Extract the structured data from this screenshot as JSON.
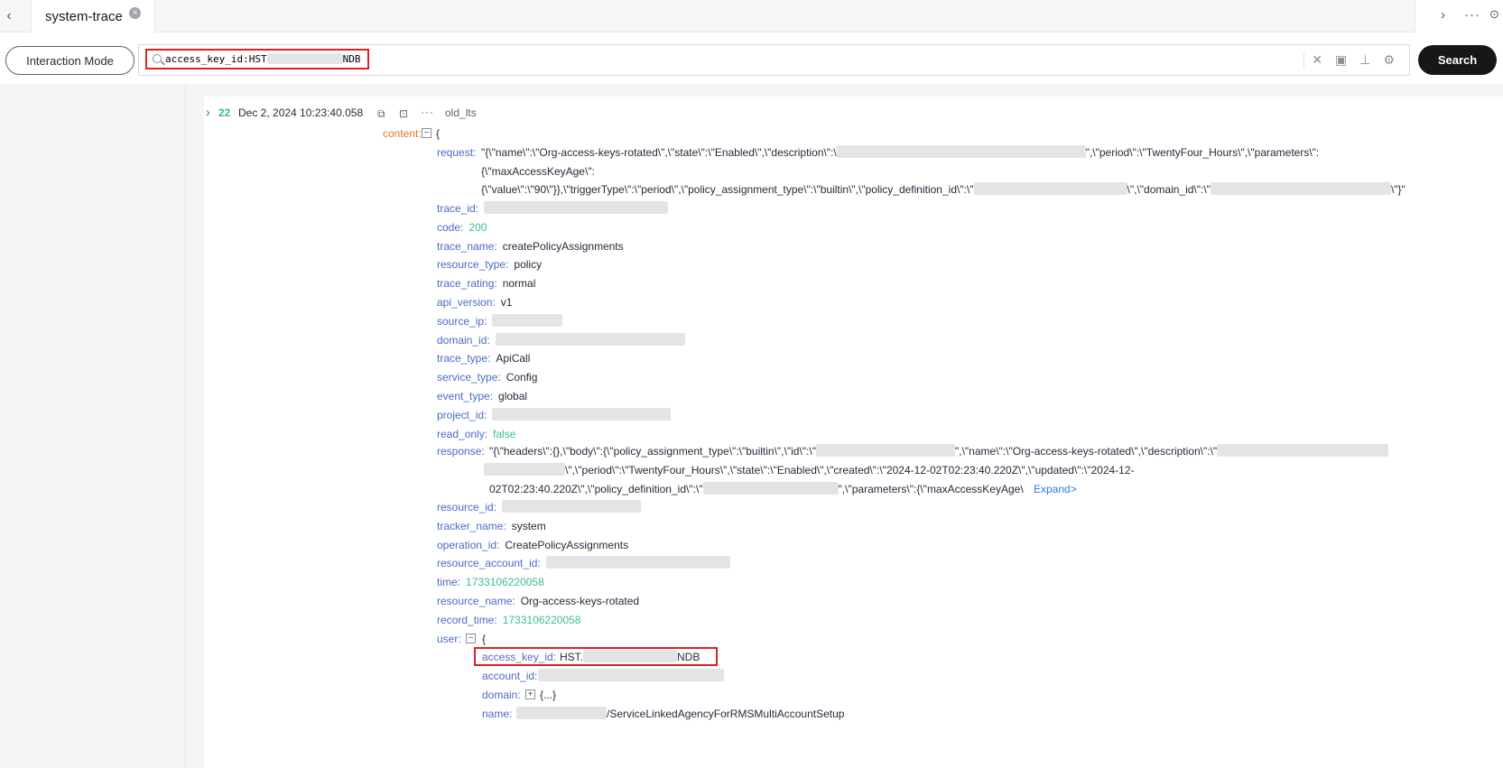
{
  "tabbar": {
    "tab_label": "system-trace"
  },
  "toolbar": {
    "interaction_mode_label": "Interaction Mode",
    "search_query_prefix": "access_key_id:HST",
    "search_query_suffix": "NDB",
    "search_button_label": "Search"
  },
  "log": {
    "row_number": "22",
    "timestamp": "Dec 2, 2024 10:23:40.058",
    "source": "old_lts",
    "content_key": "content:",
    "open_brace": "{",
    "request": {
      "key": "request:",
      "line1_a": "\"{\\\"name\\\":\\\"Org-access-keys-rotated\\\",\\\"state\\\":\\\"Enabled\\\",\\\"description\\\":\\",
      "line1_b": "\",\\\"period\\\":\\\"TwentyFour_Hours\\\",\\\"parameters\\\":",
      "line2": "{\\\"maxAccessKeyAge\\\":",
      "line3_a": "{\\\"value\\\":\\\"90\\\"}},\\\"triggerType\\\":\\\"period\\\",\\\"policy_assignment_type\\\":\\\"builtin\\\",\\\"policy_definition_id\\\":\\\"",
      "line3_b": "\\\",\\\"domain_id\\\":\\\"",
      "line3_c": "\\\"}\""
    },
    "fields": [
      {
        "key": "trace_id:",
        "value": "",
        "kind": "blur"
      },
      {
        "key": "code:",
        "value": "200",
        "kind": "num"
      },
      {
        "key": "trace_name:",
        "value": "createPolicyAssignments",
        "kind": "text"
      },
      {
        "key": "resource_type:",
        "value": "policy",
        "kind": "text"
      },
      {
        "key": "trace_rating:",
        "value": "normal",
        "kind": "text"
      },
      {
        "key": "api_version:",
        "value": "v1",
        "kind": "text"
      },
      {
        "key": "source_ip:",
        "value": "",
        "kind": "blur"
      },
      {
        "key": "domain_id:",
        "value": "",
        "kind": "blur"
      },
      {
        "key": "trace_type:",
        "value": "ApiCall",
        "kind": "text"
      },
      {
        "key": "service_type:",
        "value": "Config",
        "kind": "text"
      },
      {
        "key": "event_type:",
        "value": "global",
        "kind": "text"
      },
      {
        "key": "project_id:",
        "value": "",
        "kind": "blur"
      },
      {
        "key": "read_only:",
        "value": "false",
        "kind": "num"
      }
    ],
    "response": {
      "key": "response:",
      "line1_a": "\"{\\\"headers\\\":{},\\\"body\\\":{\\\"policy_assignment_type\\\":\\\"builtin\\\",\\\"id\\\":\\\"",
      "line1_b": "\",\\\"name\\\":\\\"Org-access-keys-rotated\\\",\\\"description\\\":\\\"",
      "line2_b": "\\\",\\\"period\\\":\\\"TwentyFour_Hours\\\",\\\"state\\\":\\\"Enabled\\\",\\\"created\\\":\\\"2024-12-02T02:23:40.220Z\\\",\\\"updated\\\":\\\"2024-12-",
      "line3_a": "02T02:23:40.220Z\\\",\\\"policy_definition_id\\\":\\\"",
      "line3_b": "\",\\\"parameters\\\":{\\\"maxAccessKeyAge\\",
      "expand": "Expand>"
    },
    "fields2": [
      {
        "key": "resource_id:",
        "value": "",
        "kind": "blur"
      },
      {
        "key": "tracker_name:",
        "value": "system",
        "kind": "text"
      },
      {
        "key": "operation_id:",
        "value": "CreatePolicyAssignments",
        "kind": "text"
      },
      {
        "key": "resource_account_id:",
        "value": "",
        "kind": "blur"
      },
      {
        "key": "time:",
        "value": "1733106220058",
        "kind": "num"
      },
      {
        "key": "resource_name:",
        "value": "Org-access-keys-rotated",
        "kind": "text"
      },
      {
        "key": "record_time:",
        "value": "1733106220058",
        "kind": "num"
      }
    ],
    "user": {
      "key": "user:",
      "open_brace": "{",
      "access_key_id_key": "access_key_id:",
      "access_key_id_prefix": "HST.",
      "access_key_id_suffix": "NDB",
      "account_id_key": "account_id:",
      "domain_key": "domain:",
      "domain_collapsed": "{...}",
      "name_key": "name:",
      "name_value": "/ServiceLinkedAgencyForRMSMultiAccountSetup"
    }
  }
}
